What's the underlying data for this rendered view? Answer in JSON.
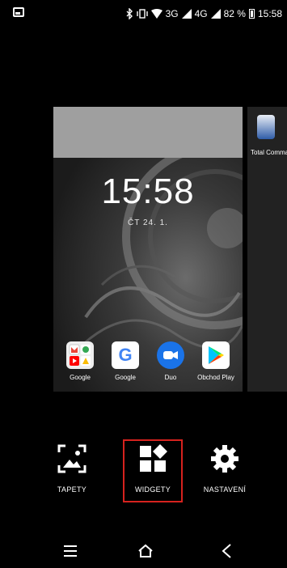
{
  "status_bar": {
    "network_3g": "3G",
    "network_4g": "4G",
    "battery": "82 %",
    "time": "15:58"
  },
  "preview": {
    "clock": "15:58",
    "date": "ČT 24. 1.",
    "apps": [
      {
        "label": "Google",
        "icon": "google-apps-folder-icon"
      },
      {
        "label": "Google",
        "icon": "google-icon"
      },
      {
        "label": "Duo",
        "icon": "duo-icon"
      },
      {
        "label": "Obchod Play",
        "icon": "play-store-icon"
      }
    ]
  },
  "side_app": {
    "label": "Total Comma",
    "icon": "total-commander-icon"
  },
  "actions": {
    "wallpapers": "TAPETY",
    "widgets": "WIDGETY",
    "settings": "NASTAVENÍ"
  },
  "colors": {
    "highlight": "#d6221e",
    "background": "#000000",
    "preview_top": "#9f9f9f"
  }
}
